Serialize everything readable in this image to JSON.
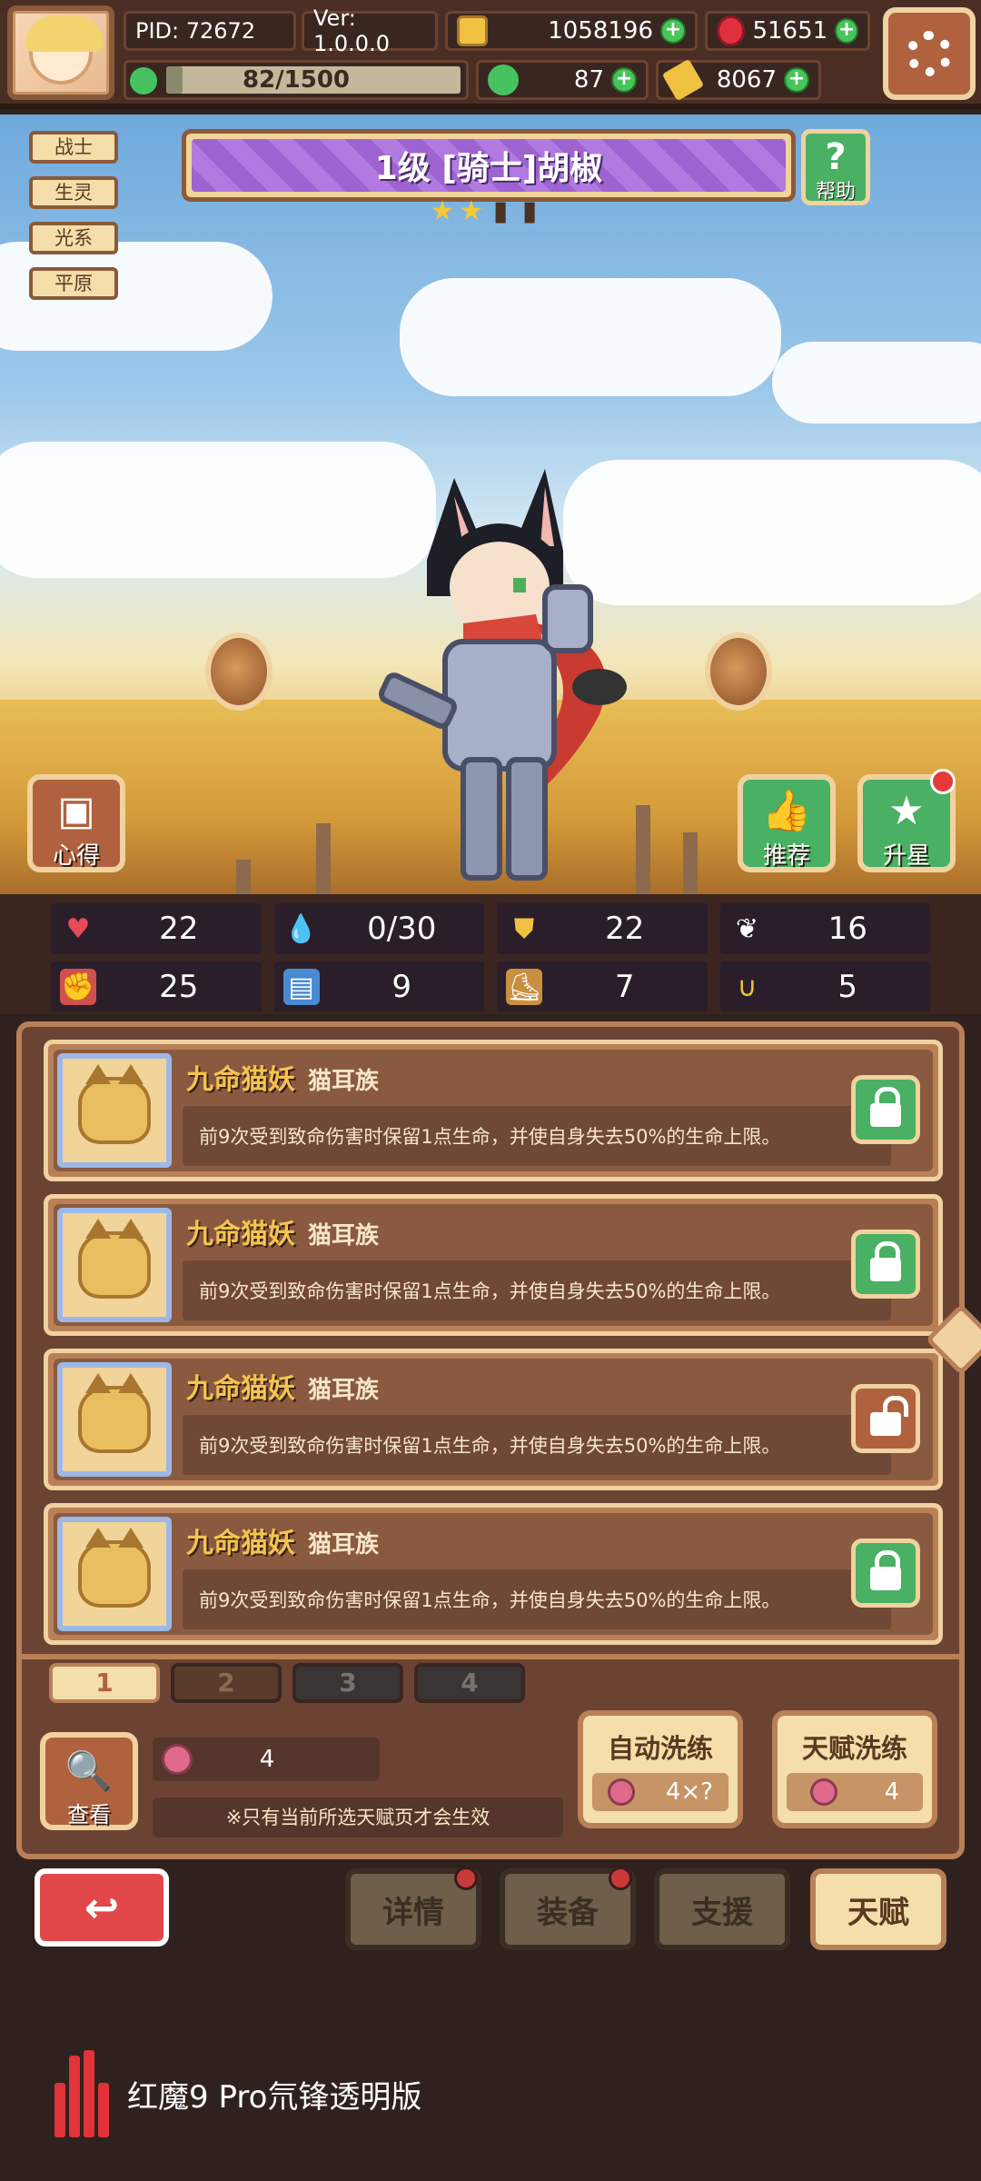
{
  "topbar": {
    "pid": "PID: 72672",
    "version": "Ver: 1.0.0.0",
    "gold": "1058196",
    "ruby": "51651",
    "stamina": "82/1500",
    "stamina_fraction": 0.055,
    "clover": "87",
    "key": "8067"
  },
  "tags": [
    "战士",
    "生灵",
    "光系",
    "平原"
  ],
  "hero": {
    "title": "1级  [骑士]胡椒",
    "stars_filled": 2,
    "stars_total": 4
  },
  "buttons": {
    "help": "帮助",
    "notes": "心得",
    "recommend": "推荐",
    "star_up": "升星"
  },
  "stats": [
    {
      "icon": "heart-icon",
      "value": "22"
    },
    {
      "icon": "mana-drop-icon",
      "value": "0/30"
    },
    {
      "icon": "shield-icon",
      "value": "22"
    },
    {
      "icon": "wing-icon",
      "value": "16"
    },
    {
      "icon": "fist-icon",
      "value": "25"
    },
    {
      "icon": "book-icon",
      "value": "9"
    },
    {
      "icon": "boot-icon",
      "value": "7"
    },
    {
      "icon": "horseshoe-icon",
      "value": "5"
    }
  ],
  "talents": [
    {
      "name": "九命猫妖",
      "type": "猫耳族",
      "desc": "前9次受到致命伤害时保留1点生命，并使自身失去50%的生命上限。",
      "locked": true
    },
    {
      "name": "九命猫妖",
      "type": "猫耳族",
      "desc": "前9次受到致命伤害时保留1点生命，并使自身失去50%的生命上限。",
      "locked": true
    },
    {
      "name": "九命猫妖",
      "type": "猫耳族",
      "desc": "前9次受到致命伤害时保留1点生命，并使自身失去50%的生命上限。",
      "locked": false
    },
    {
      "name": "九命猫妖",
      "type": "猫耳族",
      "desc": "前9次受到致命伤害时保留1点生命，并使自身失去50%的生命上限。",
      "locked": true
    }
  ],
  "pages": [
    "1",
    "2",
    "3",
    "4"
  ],
  "talent_panel": {
    "view": "查看",
    "gem_count": "4",
    "notice": "※只有当前所选天赋页才会生效",
    "auto_reroll": "自动洗练",
    "auto_cost": "4×?",
    "reroll": "天赋洗练",
    "reroll_cost": "4"
  },
  "bottom_nav": {
    "back": "↩",
    "details": "详情",
    "equip": "装备",
    "support": "支援",
    "talent": "天赋"
  },
  "watermark": "红魔9 Pro氘锋透明版",
  "colors": {
    "green_button": "#49b064",
    "brown_button": "#b0623e",
    "red_button": "#e2474a",
    "talent_name": "#f4c44e",
    "title_purple": "#9d63d0"
  }
}
